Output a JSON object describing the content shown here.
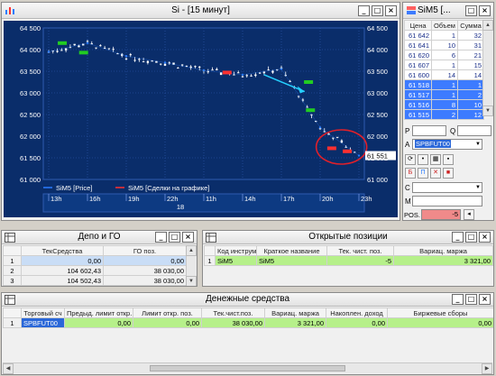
{
  "chart_window": {
    "title": "Si - [15 минут]",
    "y_ticks_left": [
      "64 500",
      "64 000",
      "63 500",
      "63 000",
      "62 500",
      "62 000",
      "61 500",
      "61 000"
    ],
    "y_ticks_right": [
      "64 500",
      "64 000",
      "63 500",
      "63 000",
      "62 500",
      "62 000",
      "61 551",
      "61 000"
    ],
    "last_price": "61 551",
    "legend": [
      {
        "label": "SiM5 [Price]",
        "color": "#2a7cff"
      },
      {
        "label": "SiM5 [Сделки на графике]",
        "color": "#ff3030"
      }
    ],
    "x_ticks": [
      "13h",
      "16h",
      "19h",
      "22h",
      "11h",
      "14h",
      "17h",
      "20h",
      "23h"
    ],
    "date_label": "18",
    "colors": {
      "background": "#0a2d6a",
      "grid": "#2f5bb0",
      "candle": "#ffffff",
      "buy_mark": "#22cc22",
      "sell_mark": "#ff3030",
      "arrow": "#25d0ff",
      "circle": "#e0202a"
    }
  },
  "chart_data": {
    "type": "line",
    "ylim": [
      61000,
      64500
    ],
    "x": [
      "13h",
      "16h",
      "19h",
      "22h",
      "11h",
      "14h",
      "17h",
      "20h",
      "23h"
    ],
    "series": [
      {
        "name": "SiM5 [Price]",
        "values": [
          63950,
          64150,
          63850,
          63700,
          63520,
          63420,
          63550,
          62200,
          61551
        ]
      }
    ]
  },
  "order_book": {
    "title": "SiM5 [...",
    "headers": [
      "Цена",
      "Объем",
      "Сумма"
    ],
    "sell_rows": [
      [
        "61 642",
        "1",
        "32"
      ],
      [
        "61 641",
        "10",
        "31"
      ],
      [
        "61 620",
        "6",
        "21"
      ],
      [
        "61 607",
        "1",
        "15"
      ],
      [
        "61 600",
        "14",
        "14"
      ]
    ],
    "buy_rows": [
      [
        "61 518",
        "1",
        "1"
      ],
      [
        "61 517",
        "1",
        "2"
      ],
      [
        "61 516",
        "8",
        "10"
      ],
      [
        "61 515",
        "2",
        "12"
      ]
    ],
    "form": {
      "p_label": "P",
      "q_label": "Q",
      "a_label": "A",
      "a_value": "SPBFUT00",
      "c_label": "C",
      "m_label": "M",
      "pos_label": "POS.",
      "pos_value": "-5"
    }
  },
  "depo": {
    "title": "Депо и ГО",
    "headers": [
      "",
      "ТекСредства",
      "ГО поз."
    ],
    "rows": [
      [
        "1",
        "0,00",
        "0,00"
      ],
      [
        "2",
        "104 602,43",
        "38 030,00"
      ],
      [
        "3",
        "104 502,43",
        "38 030,00"
      ]
    ]
  },
  "positions": {
    "title": "Открытые позиции",
    "headers": [
      "",
      "Код инструм",
      "Краткое название",
      "Тек. чист. поз.",
      "Вариац. маржа"
    ],
    "rows": [
      [
        "1",
        "SiM5",
        "SiM5",
        "-5",
        "3 321,00"
      ]
    ]
  },
  "money": {
    "title": "Денежные средства",
    "headers": [
      "",
      "Торговый сч",
      "Предыд. лимит откр. поз.",
      "Лимит откр. поз.",
      "Тек.чист.поз.",
      "Вариац. маржа",
      "Накоплен. доход",
      "Биржевые сборы"
    ],
    "rows": [
      [
        "1",
        "SPBFUT00",
        "0,00",
        "0,00",
        "38 030,00",
        "3 321,00",
        "0,00",
        "0,00"
      ]
    ]
  }
}
